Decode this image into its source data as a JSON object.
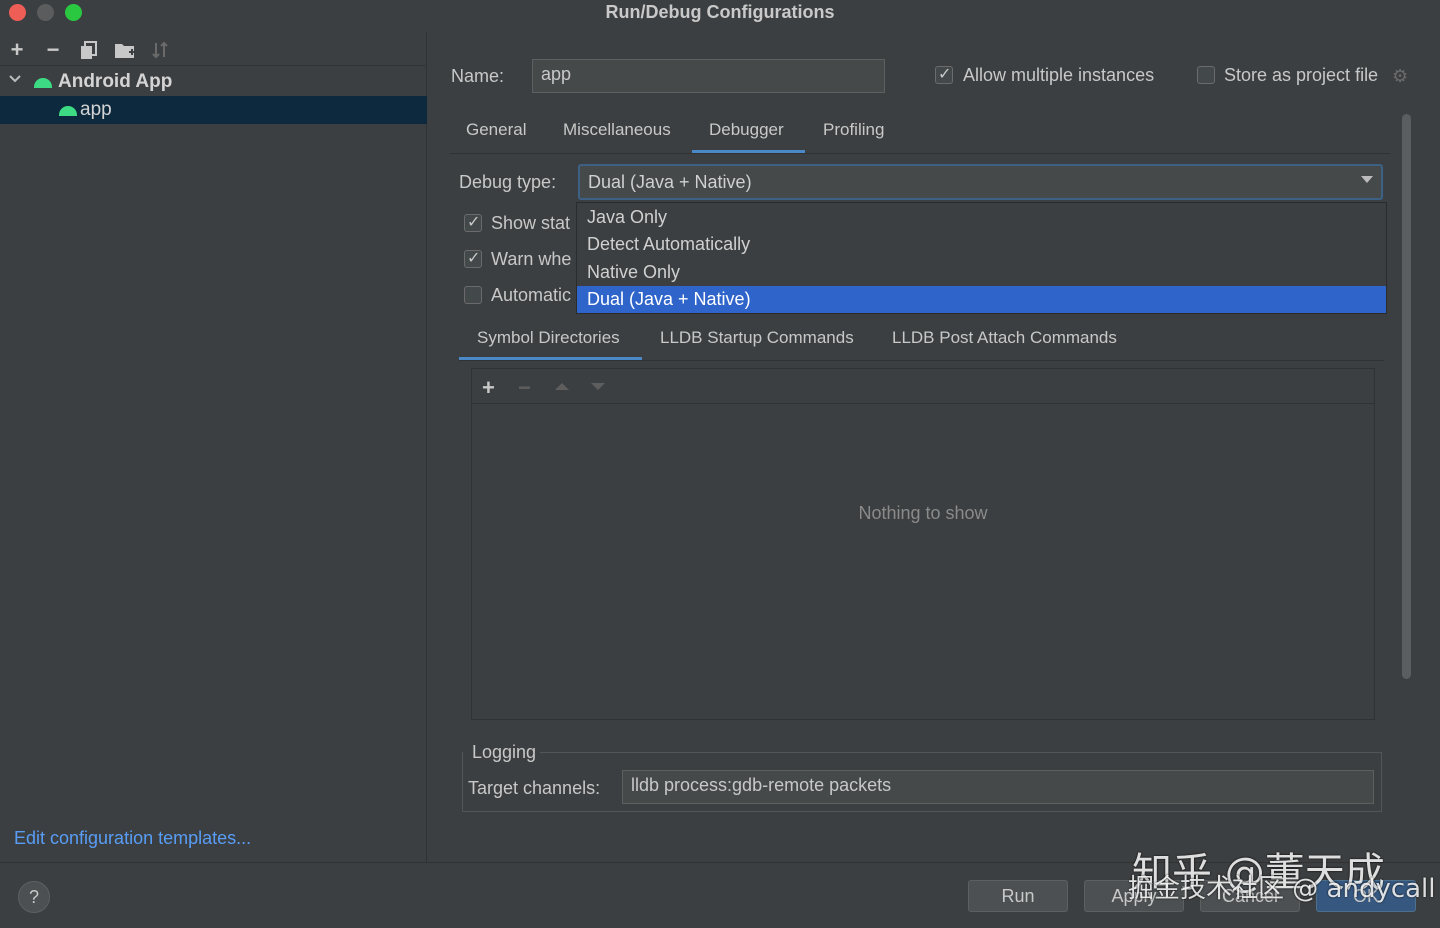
{
  "window": {
    "title": "Run/Debug Configurations"
  },
  "sidebar": {
    "toolbar": {
      "add": "+",
      "remove": "−"
    },
    "tree": {
      "root_label": "Android App",
      "child_label": "app"
    },
    "edit_templates_link": "Edit configuration templates..."
  },
  "header": {
    "name_label": "Name:",
    "name_value": "app",
    "allow_multiple_label": "Allow multiple instances",
    "allow_multiple_checked": true,
    "store_project_label": "Store as project file",
    "store_project_checked": false
  },
  "tabs": [
    {
      "label": "General"
    },
    {
      "label": "Miscellaneous"
    },
    {
      "label": "Debugger"
    },
    {
      "label": "Profiling"
    }
  ],
  "active_tab": "Debugger",
  "debugger": {
    "debug_type_label": "Debug type:",
    "debug_type_value": "Dual (Java + Native)",
    "dropdown_options": [
      {
        "label": "Java Only"
      },
      {
        "label": "Detect Automatically"
      },
      {
        "label": "Native Only"
      },
      {
        "label": "Dual (Java + Native)"
      }
    ],
    "checkboxes": [
      {
        "label": "Show stat",
        "checked": true
      },
      {
        "label": "Warn whe",
        "checked": true
      },
      {
        "label": "Automatic",
        "checked": false
      }
    ],
    "subtabs": [
      {
        "label": "Symbol Directories"
      },
      {
        "label": "LLDB Startup Commands"
      },
      {
        "label": "LLDB Post Attach Commands"
      }
    ],
    "list_toolbar": {
      "add": "+",
      "remove": "−"
    },
    "empty_text": "Nothing to show",
    "logging": {
      "title": "Logging",
      "target_label": "Target channels:",
      "target_value": "lldb process:gdb-remote packets"
    }
  },
  "footer": {
    "help": "?",
    "run": "Run",
    "apply": "Apply",
    "cancel": "Cancel",
    "ok": "OK"
  },
  "watermark": {
    "line1": "知乎 @董天成",
    "line2": "掘金技术社区 @ andycall"
  },
  "colors": {
    "background": "#3c3f41",
    "accent": "#2f65ca",
    "tab_underline": "#4a88c7",
    "link": "#589df6",
    "android_green": "#3ddc84"
  }
}
